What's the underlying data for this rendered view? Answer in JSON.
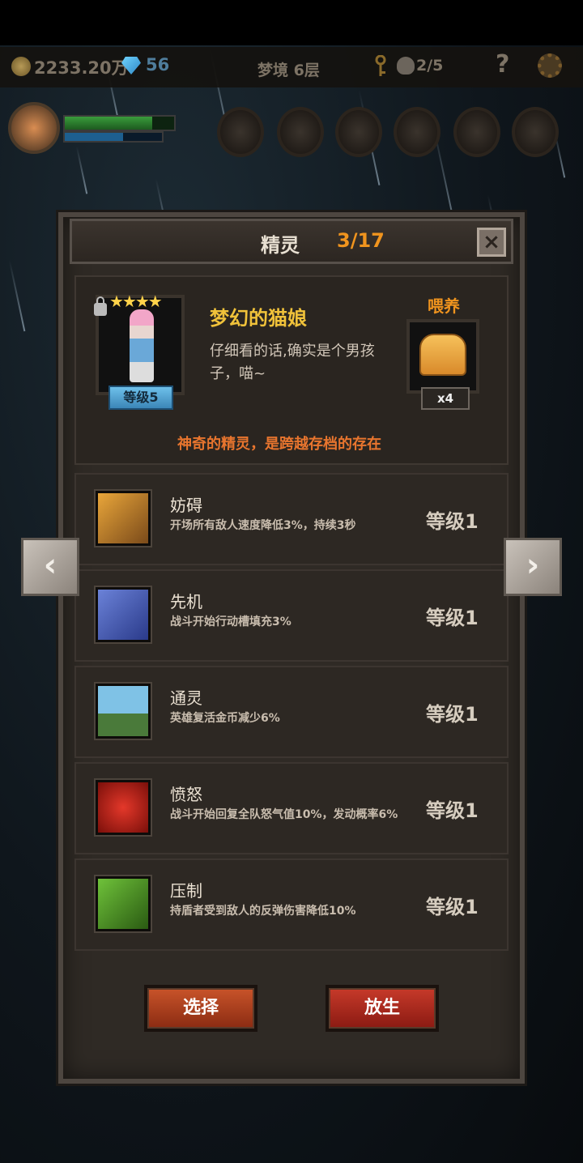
{
  "hud": {
    "gold": "2233.20万",
    "gems": "56",
    "location": "梦境 6层",
    "keys_skulls": "2/5",
    "help_icon": "question-mark",
    "settings_icon": "gear-icon"
  },
  "dialog": {
    "title": "精灵",
    "count": "3/17",
    "close_label": "×"
  },
  "pet": {
    "stars": "★★★★",
    "level": "等级5",
    "name": "梦幻的猫娘",
    "description": "仔细看的话,确实是个男孩子，喵~",
    "feed_label": "喂养",
    "feed_qty": "x4",
    "tagline": "神奇的精灵，是跨越存档的存在"
  },
  "skills": [
    {
      "name": "妨碍",
      "desc": "开场所有敌人速度降低3%，持续3秒",
      "level": "等级1",
      "icon": "chained-boot-icon",
      "color1": "#e9a63a",
      "color2": "#7a4a1a"
    },
    {
      "name": "先机",
      "desc": "战斗开始行动槽填充3%",
      "level": "等级1",
      "icon": "leopard-icon",
      "color1": "#6b82d8",
      "color2": "#2a3a8a"
    },
    {
      "name": "通灵",
      "desc": "英雄复活金币减少6%",
      "level": "等级1",
      "icon": "tombstone-icon",
      "color1": "#7fc2e6",
      "color2": "#4a7a3a"
    },
    {
      "name": "愤怒",
      "desc": "战斗开始回复全队怒气值10%，发动概率6%",
      "level": "等级1",
      "icon": "roaring-beast-icon",
      "color1": "#e4382a",
      "color2": "#7a0f0a"
    },
    {
      "name": "压制",
      "desc": "持盾者受到敌人的反弹伤害降低10%",
      "level": "等级1",
      "icon": "beast-paw-icon",
      "color1": "#6fc23a",
      "color2": "#2a5a12"
    }
  ],
  "nav": {
    "prev_label": "‹",
    "next_label": "›"
  },
  "buttons": {
    "select": "选择",
    "release": "放生"
  }
}
